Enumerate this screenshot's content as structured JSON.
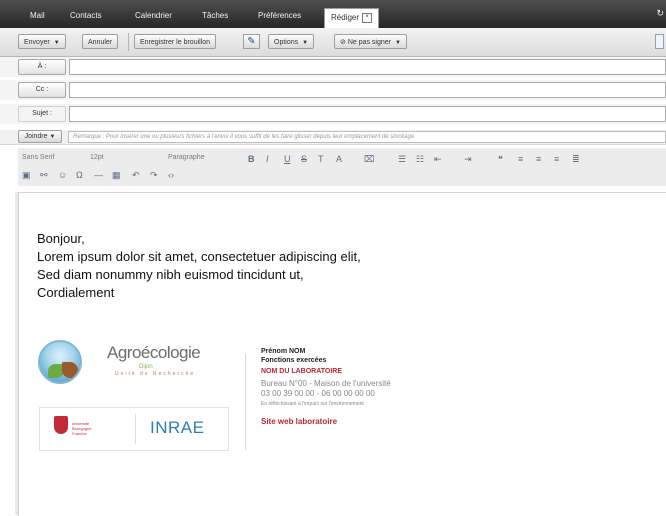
{
  "nav": {
    "tabs": [
      {
        "label": "Mail"
      },
      {
        "label": "Contacts"
      },
      {
        "label": "Calendrier"
      },
      {
        "label": "Tâches"
      },
      {
        "label": "Préférences"
      },
      {
        "label": "Rédiger",
        "active": true
      }
    ]
  },
  "toolbar": {
    "send": "Envoyer",
    "cancel": "Annuler",
    "save_draft": "Enregistrer le brouillon",
    "options": "Options",
    "no_sign": "Ne pas signer"
  },
  "fields": {
    "to_label": "À :",
    "cc_label": "Cc :",
    "subject_label": "Sujet :"
  },
  "attach": {
    "button": "Joindre",
    "hint": "Remarque : Pour insérer une ou plusieurs fichiers à l'envoi il vous suffit de les faire glisser depuis leur emplacement de stockage"
  },
  "format": {
    "font": "Sans Serif",
    "size": "12pt",
    "block": "Paragraphe",
    "bold": "B",
    "italic": "I",
    "underline": "U"
  },
  "message": {
    "lines": [
      "Bonjour,",
      "Lorem ipsum dolor sit amet, consectetuer adipiscing elit,",
      "Sed diam nonummy nibh euismod tincidunt ut,",
      "Cordialement"
    ]
  },
  "signature": {
    "logo_name": "Agroécologie",
    "logo_sub1": "Dijon",
    "logo_sub2": "Unité de Recherche",
    "ub_text": "université\nBourgogne\nFranche",
    "inrae": "INRAE",
    "name": "Prénom NOM",
    "role": "Fonctions exercées",
    "lab": "NOM DU LABORATOIRE",
    "address": "Bureau N°00 - Maison de l'université",
    "phone": "03 00 39 00 00 - 06 00 00 00 00",
    "disclaimer": "En réfléchissant à l'impact sur l'environnement",
    "website": "Site web laboratoire"
  },
  "colors": {
    "accent_red": "#b42a36",
    "inrae_blue": "#2b7fb6",
    "agro_green": "#7fb24e"
  }
}
